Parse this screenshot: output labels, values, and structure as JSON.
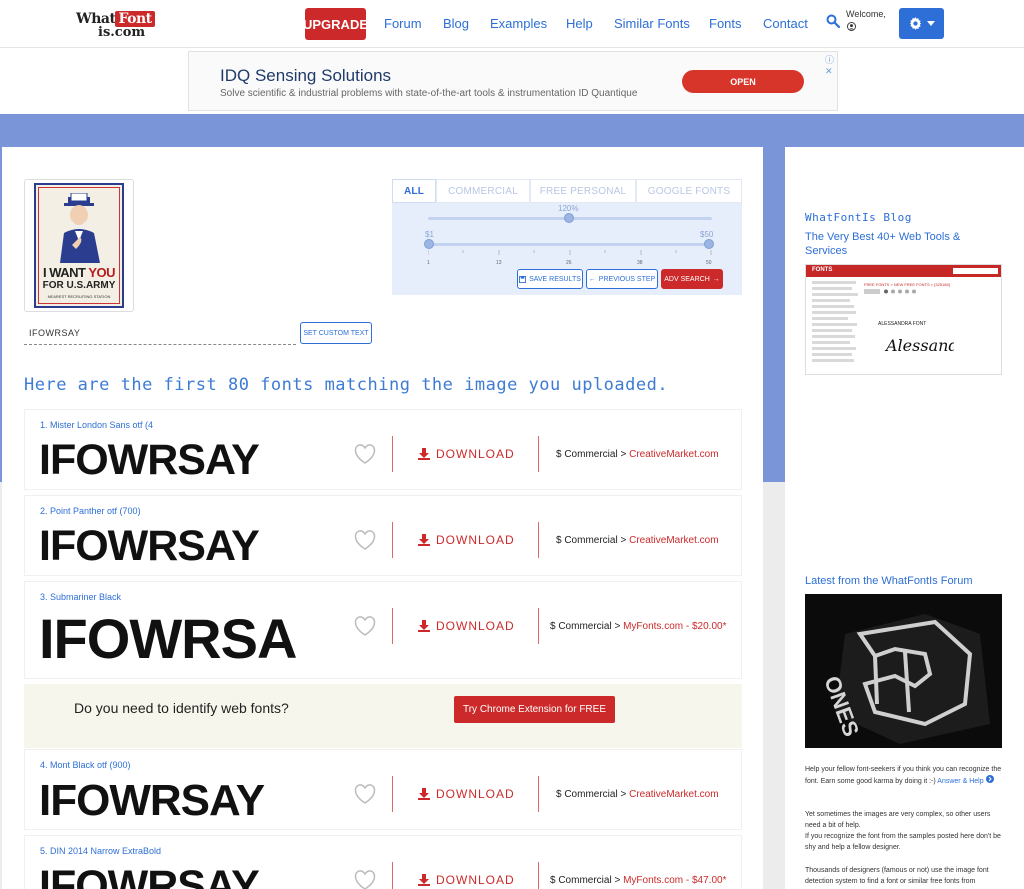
{
  "nav": {
    "logo_top": "What",
    "logo_badge": "Font",
    "logo_bottom": "is.com",
    "upgrade": "UPGRADE",
    "links": [
      "Forum",
      "Blog",
      "Examples",
      "Help",
      "Similar Fonts",
      "Fonts",
      "Contact"
    ],
    "welcome": "Welcome,"
  },
  "ad": {
    "title": "IDQ Sensing Solutions",
    "subtitle": "Solve scientific & industrial problems with state-of-the-art tools & instrumentation ID Quantique",
    "cta": "OPEN",
    "close": "ⓘ ✕"
  },
  "filters": {
    "tabs": [
      "ALL",
      "COMMERCIAL",
      "FREE PERSONAL",
      "GOOGLE FONTS"
    ],
    "active_tab": "ALL",
    "size_label": "120%",
    "size_value_pct": 120,
    "price_min_label": "$1",
    "price_max_label": "$50",
    "price_ticks": [
      "1",
      "13",
      "26",
      "38",
      "50"
    ],
    "save": "SAVE RESULTS",
    "previous": "PREVIOUS STEP",
    "adv": "ADV SEARCH"
  },
  "poster": {
    "line1a": "I WANT ",
    "line1b": "YOU",
    "line2": "FOR U.S.ARMY",
    "line3": "NEAREST RECRUITING STATION"
  },
  "sample": {
    "value": "IFOWRSAY",
    "button": "SET CUSTOM TEXT"
  },
  "headline": "Here are the first 80 fonts matching the image you uploaded.",
  "results": [
    {
      "name": "1. Mister London Sans otf (4",
      "sample": "IFOWRSAY",
      "download": "DOWNLOAD",
      "license": "$ Commercial >",
      "vendor": "CreativeMarket.com"
    },
    {
      "name": "2. Point Panther otf (700)",
      "sample": "IFOWRSAY",
      "download": "DOWNLOAD",
      "license": "$ Commercial >",
      "vendor": "CreativeMarket.com"
    },
    {
      "name": "3. Submariner Black",
      "sample": "IFOWRSA",
      "download": "DOWNLOAD",
      "license": "$ Commercial >",
      "vendor": "MyFonts.com - $20.00*"
    },
    {
      "name": "4. Mont Black otf (900)",
      "sample": "IFOWRSAY",
      "download": "DOWNLOAD",
      "license": "$ Commercial >",
      "vendor": "CreativeMarket.com"
    },
    {
      "name": "5. DIN 2014 Narrow ExtraBold",
      "sample": "IFOWRSAY",
      "download": "DOWNLOAD",
      "license": "$ Commercial >",
      "vendor": "MyFonts.com - $47.00*"
    }
  ],
  "promo": {
    "text": "Do you need to identify web fonts?",
    "button": "Try Chrome Extension for FREE"
  },
  "sidebar": {
    "blog_heading": "WhatFontIs Blog",
    "blog_link": "The Very Best 40+ Web Tools & Services",
    "blog_thumb": {
      "bar_label": "FONTS",
      "header": "FREE FONTS > NEW FREE FONTS > [325185]",
      "title": "ALESSANDRA FONT",
      "script_text": "Alessandra"
    },
    "forum_heading": "Latest from the WhatFontIs Forum",
    "p1": "Help your fellow font-seekers if you think you can recognize the font. Earn some good karma by doing it :-)",
    "p1_link": "Answer & Help",
    "p2": "Yet sometimes the images are very complex, so other users need a bit of help.",
    "p3": "If you recognize the font from the samples posted here don't be shy and help a fellow designer.",
    "p4": "Thousands of designers (famous or not) use the image font detection system to find a font or similar free fonts from"
  },
  "colors": {
    "brand_red": "#cc2a2a",
    "link_blue": "#2d6fd6",
    "hero_blue": "#7b95d9"
  }
}
